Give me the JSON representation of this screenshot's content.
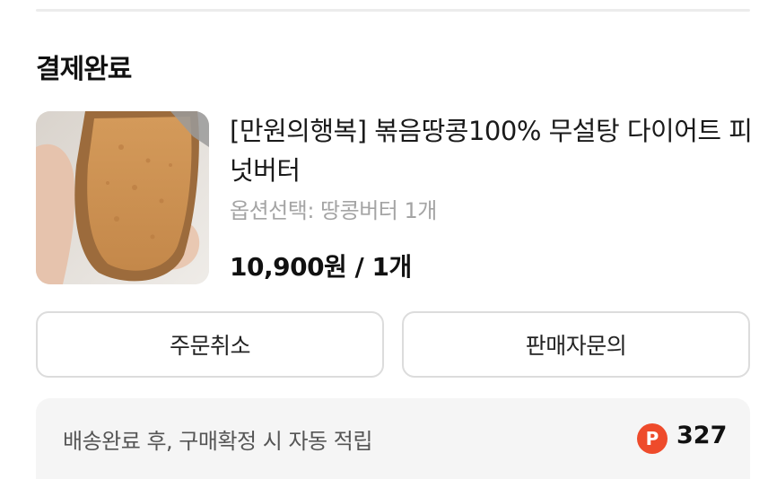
{
  "order": {
    "status": "결제완료"
  },
  "product": {
    "name": "[만원의행복] 볶음땅콩100% 무설탕 다이어트 피넛버터",
    "option": "옵션선택: 땅콩버터 1개",
    "price": "10,900원 / 1개",
    "image": "peanut-butter-on-bread-photo"
  },
  "actions": {
    "cancel_label": "주문취소",
    "inquiry_label": "판매자문의"
  },
  "points": {
    "description": "배송완료 후, 구매확정 시 자동 적립",
    "icon_letter": "P",
    "value": "327",
    "icon_color": "#ee4b2b"
  }
}
